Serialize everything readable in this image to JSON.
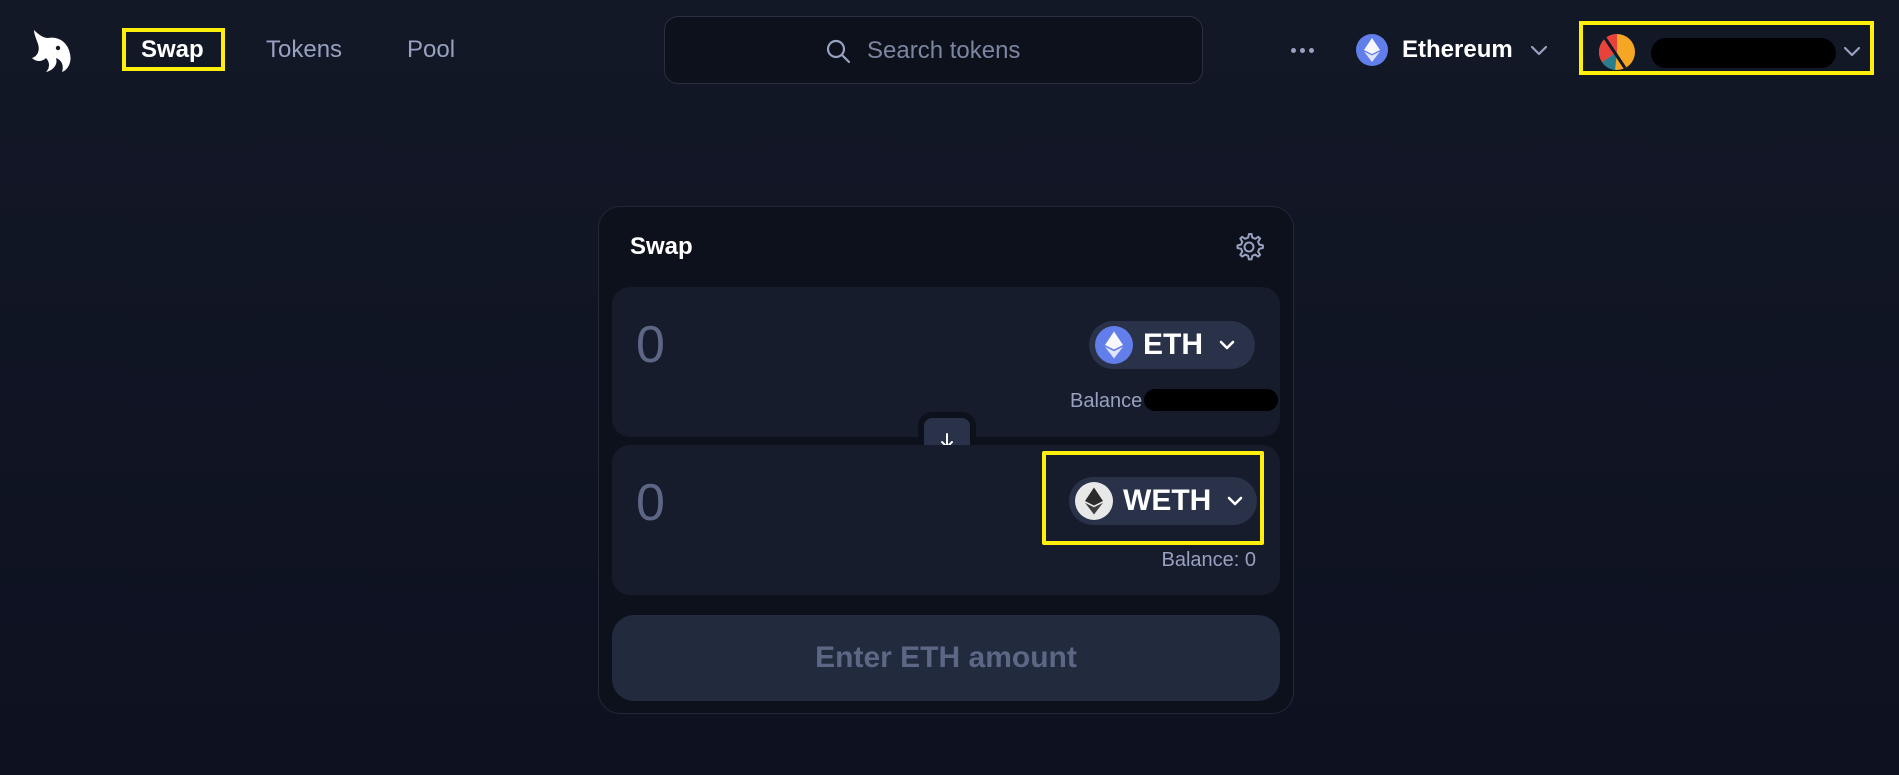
{
  "nav": {
    "items": [
      {
        "label": "Swap",
        "active": true
      },
      {
        "label": "Tokens",
        "active": false
      },
      {
        "label": "Pool",
        "active": false
      }
    ]
  },
  "search": {
    "placeholder": "Search tokens"
  },
  "network": {
    "label": "Ethereum",
    "icon": "ethereum-icon"
  },
  "account": {
    "avatar": "account-avatar",
    "address_redacted": true
  },
  "swap": {
    "title": "Swap",
    "input": {
      "amount_placeholder": "0",
      "token": "ETH",
      "balance_label": "Balance"
    },
    "output": {
      "amount_placeholder": "0",
      "token": "WETH",
      "balance_text": "Balance: 0"
    },
    "submit_label": "Enter ETH amount"
  },
  "colors": {
    "background": "#131827",
    "card": "#0d111c",
    "panel": "#161c2b",
    "token_pill": "#293249",
    "muted_text": "#98a1c0",
    "eth_blue": "#627eea",
    "highlight": "#ffef0a"
  }
}
